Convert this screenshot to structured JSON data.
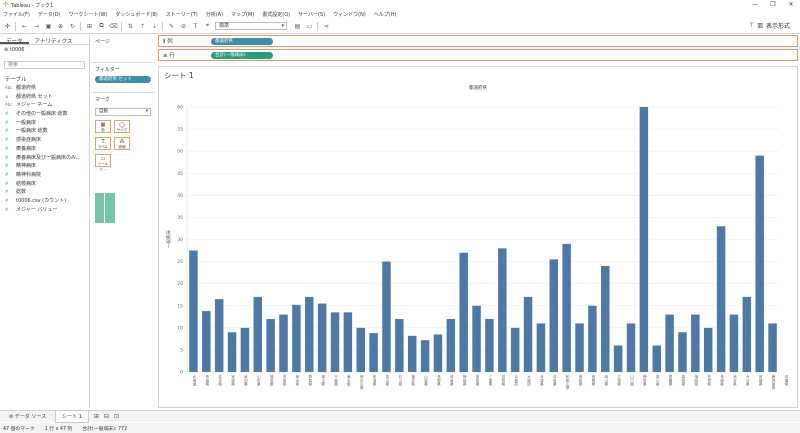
{
  "window": {
    "title": "Tableau - ブック1",
    "minimize": "—",
    "restore": "❐",
    "close": "✕"
  },
  "menu": [
    "ファイル(F)",
    "データ(D)",
    "ワークシート(W)",
    "ダッシュボード(B)",
    "ストーリー(T)",
    "分析(A)",
    "マップ(M)",
    "書式設定(O)",
    "サーバー(S)",
    "ウィンドウ(N)",
    "ヘルプ(H)"
  ],
  "toolbar": {
    "fit_select": "標準",
    "show_me": "表示形式"
  },
  "data_pane": {
    "tab_data": "データ",
    "tab_analytics": "アナリティクス",
    "datasource": "t0006",
    "search_placeholder": "検索",
    "section_table": "テーブル",
    "fields": [
      {
        "type": "Abc",
        "kind": "dim",
        "name": "都道府県"
      },
      {
        "type": "⊘",
        "kind": "dim",
        "name": "都道府県 セット"
      },
      {
        "type": "Abc",
        "kind": "dim",
        "name": "メジャー ネーム"
      },
      {
        "type": "#",
        "kind": "mea",
        "name": "その他の一般病床 総数"
      },
      {
        "type": "#",
        "kind": "mea",
        "name": "一般病床"
      },
      {
        "type": "#",
        "kind": "mea",
        "name": "一般病床 総数"
      },
      {
        "type": "#",
        "kind": "mea",
        "name": "感染症病床"
      },
      {
        "type": "#",
        "kind": "mea",
        "name": "療養病床"
      },
      {
        "type": "#",
        "kind": "mea",
        "name": "療養病床及び一般病床のみ..."
      },
      {
        "type": "#",
        "kind": "mea",
        "name": "精神病床"
      },
      {
        "type": "#",
        "kind": "mea",
        "name": "精神科病院"
      },
      {
        "type": "#",
        "kind": "mea",
        "name": "結核病床"
      },
      {
        "type": "#",
        "kind": "mea",
        "name": "総数"
      },
      {
        "type": "#",
        "kind": "mea",
        "name": "t0006.csv (カウント)"
      },
      {
        "type": "#",
        "kind": "mea",
        "name": "メジャー バリュー"
      }
    ]
  },
  "cards": {
    "pages_label": "ページ",
    "filters_label": "フィルター",
    "filter_pill": "都道府県 セット",
    "marks_label": "マーク",
    "mark_type": "自動",
    "mark_buttons": [
      {
        "icon": "▦",
        "label": "色"
      },
      {
        "icon": "◯",
        "label": "サイズ"
      },
      {
        "icon": "T",
        "label": "ラベル"
      },
      {
        "icon": "⁂",
        "label": "詳細"
      },
      {
        "icon": "▭",
        "label": "ツールヒ..."
      }
    ]
  },
  "shelves": {
    "columns_label": "列",
    "columns_pill": "都道府県",
    "rows_label": "行",
    "rows_pill": "合計(一般病床)"
  },
  "sheet": {
    "title": "シート 1"
  },
  "tabs": {
    "datasource": "データ ソース",
    "sheet": "シート 1"
  },
  "status": {
    "marks": "47 個のマーク",
    "rows_cols": "1 行 x 47 列",
    "sum": "合計(一般病床): 772"
  },
  "colors": {
    "bar": "#4e79a7",
    "accent": "#e8762c"
  },
  "chart_data": {
    "type": "bar",
    "title": "都道府県",
    "ylabel": "一般病床",
    "ylim": [
      0,
      60
    ],
    "yticks": [
      0,
      5,
      10,
      15,
      20,
      25,
      30,
      35,
      40,
      45,
      50,
      55,
      60
    ],
    "categories": [
      "北海道",
      "青森県",
      "岩手県",
      "宮城県",
      "秋田県",
      "山形県",
      "福島県",
      "茨城県",
      "栃木県",
      "群馬県",
      "埼玉県",
      "千葉県",
      "東京都",
      "神奈川県",
      "新潟県",
      "富山県",
      "石川県",
      "福井県",
      "山梨県",
      "長野県",
      "岐阜県",
      "静岡県",
      "愛知県",
      "三重県",
      "滋賀県",
      "京都府",
      "大阪府",
      "兵庫県",
      "奈良県",
      "和歌山県",
      "鳥取県",
      "島根県",
      "岡山県",
      "広島県",
      "山口県",
      "徳島県",
      "香川県",
      "愛媛県",
      "高知県",
      "福岡県",
      "佐賀県",
      "長崎県",
      "熊本県",
      "大分県",
      "宮崎県",
      "鹿児島県",
      "沖縄県"
    ],
    "values": [
      27.5,
      13.8,
      16.5,
      9,
      10,
      17,
      12,
      13,
      15.2,
      17,
      15.5,
      13.5,
      13.5,
      10,
      8.8,
      25,
      12,
      8.2,
      7.2,
      8.5,
      12,
      27,
      15,
      12,
      28,
      10,
      17,
      11,
      25.5,
      29,
      11,
      15,
      24,
      6,
      11,
      60,
      6,
      13,
      9,
      13,
      10,
      33,
      13,
      17,
      49,
      11
    ]
  }
}
